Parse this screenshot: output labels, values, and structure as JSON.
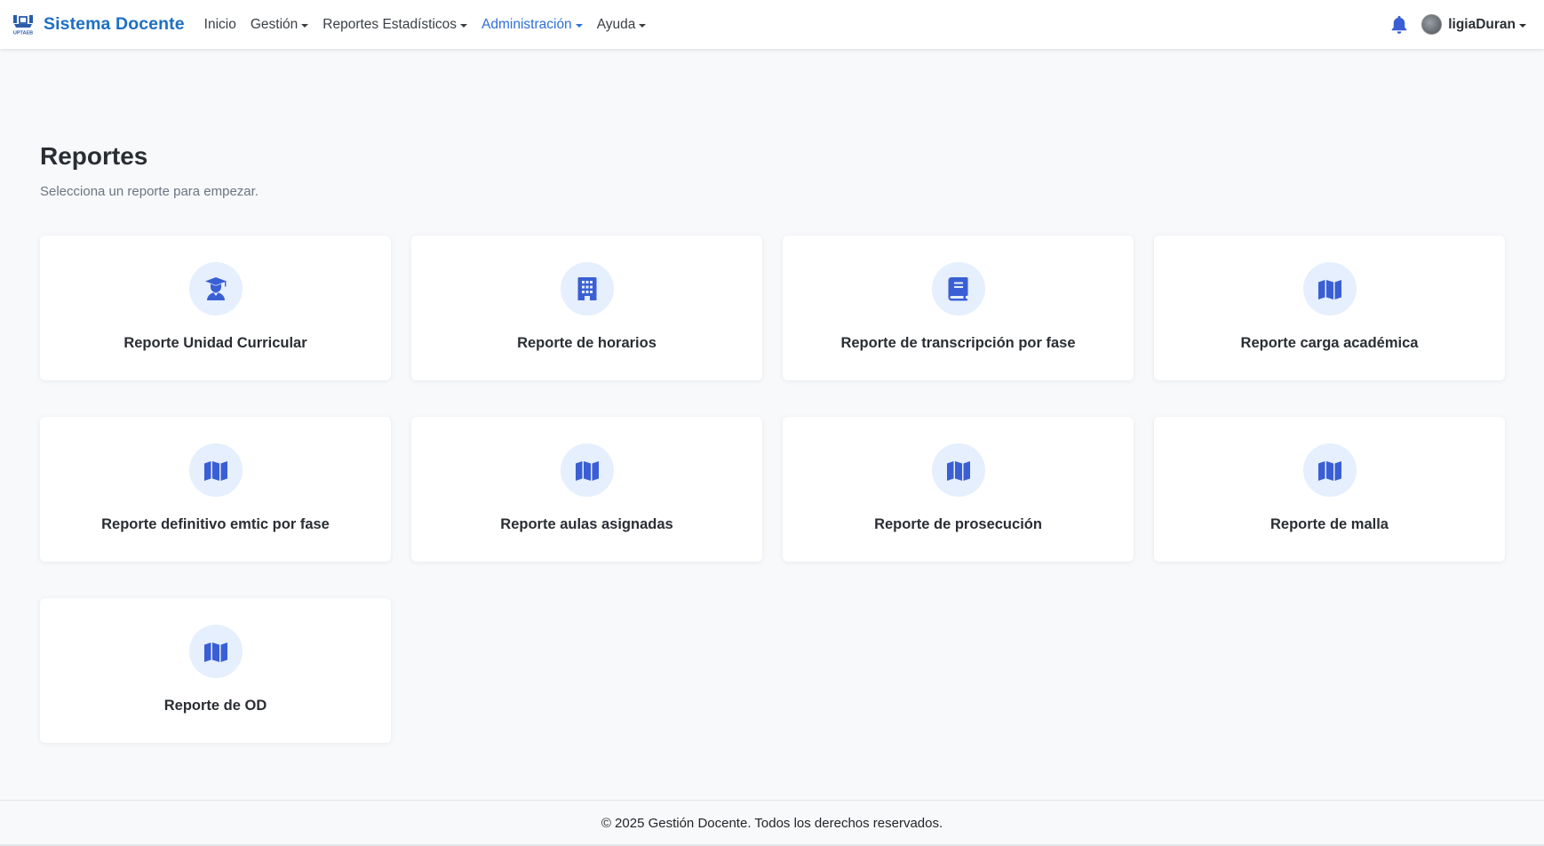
{
  "navbar": {
    "brand": "Sistema Docente",
    "logo_caption": "UPTAEB",
    "items": [
      {
        "label": "Inicio",
        "dropdown": false,
        "active": false
      },
      {
        "label": "Gestión",
        "dropdown": true,
        "active": false
      },
      {
        "label": "Reportes Estadísticos",
        "dropdown": true,
        "active": false
      },
      {
        "label": "Administración",
        "dropdown": true,
        "active": true
      },
      {
        "label": "Ayuda",
        "dropdown": true,
        "active": false
      }
    ],
    "notifications_icon": "bell-icon",
    "username": "ligiaDuran"
  },
  "main": {
    "title": "Reportes",
    "subtitle": "Selecciona un reporte para empezar."
  },
  "reports": [
    {
      "label": "Reporte Unidad Curricular",
      "icon": "graduate-icon"
    },
    {
      "label": "Reporte de horarios",
      "icon": "building-icon"
    },
    {
      "label": "Reporte de transcripción por fase",
      "icon": "book-icon"
    },
    {
      "label": "Reporte carga académica",
      "icon": "map-icon"
    },
    {
      "label": "Reporte definitivo emtic por fase",
      "icon": "map-icon"
    },
    {
      "label": "Reporte aulas asignadas",
      "icon": "map-icon"
    },
    {
      "label": "Reporte de prosecución",
      "icon": "map-icon"
    },
    {
      "label": "Reporte de malla",
      "icon": "map-icon"
    },
    {
      "label": "Reporte de OD",
      "icon": "map-icon"
    }
  ],
  "footer": {
    "text": "© 2025 Gestión Docente. Todos los derechos reservados."
  },
  "colors": {
    "brand": "#1e6fc4",
    "active_nav": "#2f6fdc",
    "icon": "#3a5fd4",
    "icon_bg": "#e5effd",
    "page_bg": "#f8f9fb"
  }
}
